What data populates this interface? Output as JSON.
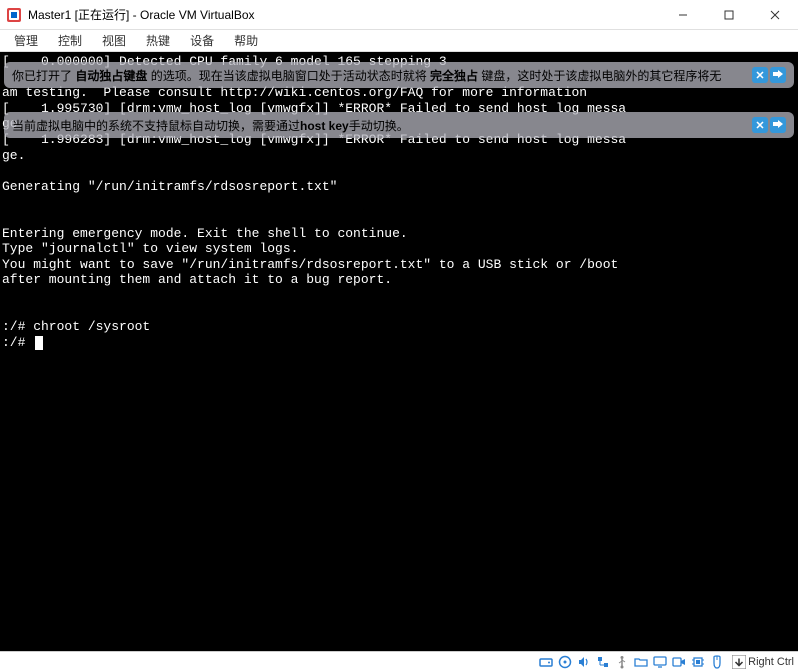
{
  "window": {
    "title": "Master1 [正在运行] - Oracle VM VirtualBox"
  },
  "menu": {
    "items": [
      "管理",
      "控制",
      "视图",
      "热键",
      "设备",
      "帮助"
    ]
  },
  "notifications": {
    "n1_pre": "你已打开了 ",
    "n1_bold1": "自动独占键盘",
    "n1_mid": " 的选项。现在当该虚拟电脑窗口处于活动状态时就将 ",
    "n1_bold2": "完全独占",
    "n1_post": " 键盘，这时处于该虚拟电脑外的其它程序将无",
    "n2_pre": "当前虚拟电脑中的系统不支持鼠标自动切换，需要通过",
    "n2_bold": "host key",
    "n2_post": "手动切换。"
  },
  "terminal": {
    "line1": "[    0.000000] Detected CPU family 6 model 165 stepping 3",
    "line2_a": "",
    "line2_b": "am testing.  Please consult http://wiki.centos.org/FAQ for more information",
    "line3": "[    1.995730] [drm:vmw_host_log [vmwgfx]] *ERROR* Failed to send host log messa",
    "line4": "ge.",
    "line5": "[    1.996283] [drm:vmw_host_log [vmwgfx]] *ERROR* Failed to send host log messa",
    "line6": "ge.",
    "line7": "",
    "line8": "Generating \"/run/initramfs/rdsosreport.txt\"",
    "line9": "",
    "line10": "",
    "line11": "Entering emergency mode. Exit the shell to continue.",
    "line12": "Type \"journalctl\" to view system logs.",
    "line13": "You might want to save \"/run/initramfs/rdsosreport.txt\" to a USB stick or /boot",
    "line14": "after mounting them and attach it to a bug report.",
    "line15": "",
    "line16": "",
    "line17": ":/# chroot /sysroot",
    "line18": ":/# "
  },
  "statusbar": {
    "host_key": "Right Ctrl"
  },
  "icons": {
    "app": "virtualbox-icon",
    "minimize": "minimize-icon",
    "maximize": "maximize-icon",
    "close": "close-icon",
    "notif_close": "notification-close-icon",
    "notif_dismiss": "notification-dismiss-icon",
    "status_hdd": "hard-disk-icon",
    "status_cd": "optical-disk-icon",
    "status_audio": "audio-icon",
    "status_net": "network-icon",
    "status_usb": "usb-icon",
    "status_shared": "shared-folder-icon",
    "status_display": "display-icon",
    "status_recording": "recording-icon",
    "status_cpu": "cpu-icon",
    "status_mouse": "mouse-icon",
    "host_key_arrow": "down-arrow-icon"
  }
}
